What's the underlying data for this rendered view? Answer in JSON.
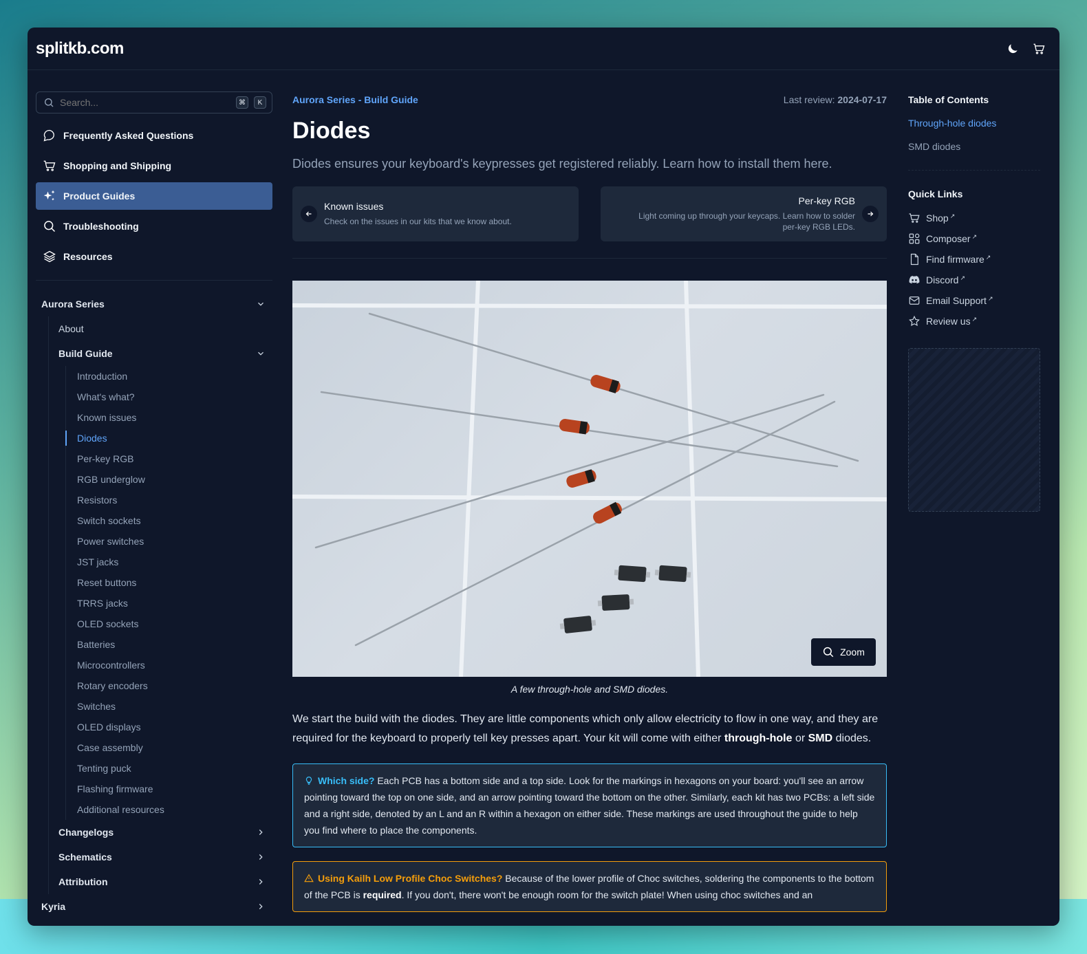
{
  "header": {
    "logo": "splitkb.com"
  },
  "sidebar": {
    "search_placeholder": "Search...",
    "kbd1": "⌘",
    "kbd2": "K",
    "nav": [
      {
        "label": "Frequently Asked Questions",
        "icon": "chat-bubble-icon"
      },
      {
        "label": "Shopping and Shipping",
        "icon": "cart-icon"
      },
      {
        "label": "Product Guides",
        "icon": "sparkles-icon",
        "active": true
      },
      {
        "label": "Troubleshooting",
        "icon": "search-icon"
      },
      {
        "label": "Resources",
        "icon": "layers-icon"
      }
    ],
    "tree": {
      "series": "Aurora Series",
      "about": "About",
      "build_guide": "Build Guide",
      "build_items": [
        "Introduction",
        "What's what?",
        "Known issues",
        "Diodes",
        "Per-key RGB",
        "RGB underglow",
        "Resistors",
        "Switch sockets",
        "Power switches",
        "JST jacks",
        "Reset buttons",
        "TRRS jacks",
        "OLED sockets",
        "Batteries",
        "Microcontrollers",
        "Rotary encoders",
        "Switches",
        "OLED displays",
        "Case assembly",
        "Tenting puck",
        "Flashing firmware",
        "Additional resources"
      ],
      "active_item": "Diodes",
      "changelogs": "Changelogs",
      "schematics": "Schematics",
      "attribution": "Attribution",
      "kyria": "Kyria"
    }
  },
  "main": {
    "breadcrumb": "Aurora Series - Build Guide",
    "review_label": "Last review:",
    "review_date": "2024-07-17",
    "title": "Diodes",
    "lead": "Diodes ensures your keyboard's keypresses get registered reliably. Learn how to install them here.",
    "prev": {
      "title": "Known issues",
      "desc": "Check on the issues in our kits that we know about."
    },
    "next": {
      "title": "Per-key RGB",
      "desc1": "Light coming up through your keycaps. Learn how to solder",
      "desc2": "per-key RGB LEDs."
    },
    "zoom_label": "Zoom",
    "caption": "A few through-hole and SMD diodes.",
    "para1_a": "We start the build with the diodes. They are little components which only allow electricity to flow in one way, and they are required for the keyboard to properly tell key presses apart. Your kit will come with either ",
    "para1_b": "through-hole",
    "para1_c": " or ",
    "para1_d": "SMD",
    "para1_e": " diodes.",
    "tip_title": "Which side?",
    "tip_text": " Each PCB has a bottom side and a top side. Look for the markings in hexagons on your board: you'll see an arrow pointing toward the top on one side, and an arrow pointing toward the bottom on the other. Similarly, each kit has two PCBs: a left side and a right side, denoted by an L and an R within a hexagon on either side. These markings are used throughout the guide to help you find where to place the components.",
    "warn_title": "Using Kailh Low Profile Choc Switches?",
    "warn_text_a": " Because of the lower profile of Choc switches, soldering the components to the bottom of the PCB is ",
    "warn_bold": "required",
    "warn_text_b": ". If you don't, there won't be enough room for the switch plate! When using choc switches and an"
  },
  "toc": {
    "title": "Table of Contents",
    "items": [
      "Through-hole diodes",
      "SMD diodes"
    ],
    "quick_title": "Quick Links",
    "quick": [
      {
        "label": "Shop",
        "icon": "cart-icon"
      },
      {
        "label": "Composer",
        "icon": "grid-icon"
      },
      {
        "label": "Find firmware",
        "icon": "file-icon"
      },
      {
        "label": "Discord",
        "icon": "discord-icon"
      },
      {
        "label": "Email Support",
        "icon": "mail-icon"
      },
      {
        "label": "Review us",
        "icon": "star-icon"
      }
    ],
    "ext": "↗"
  }
}
